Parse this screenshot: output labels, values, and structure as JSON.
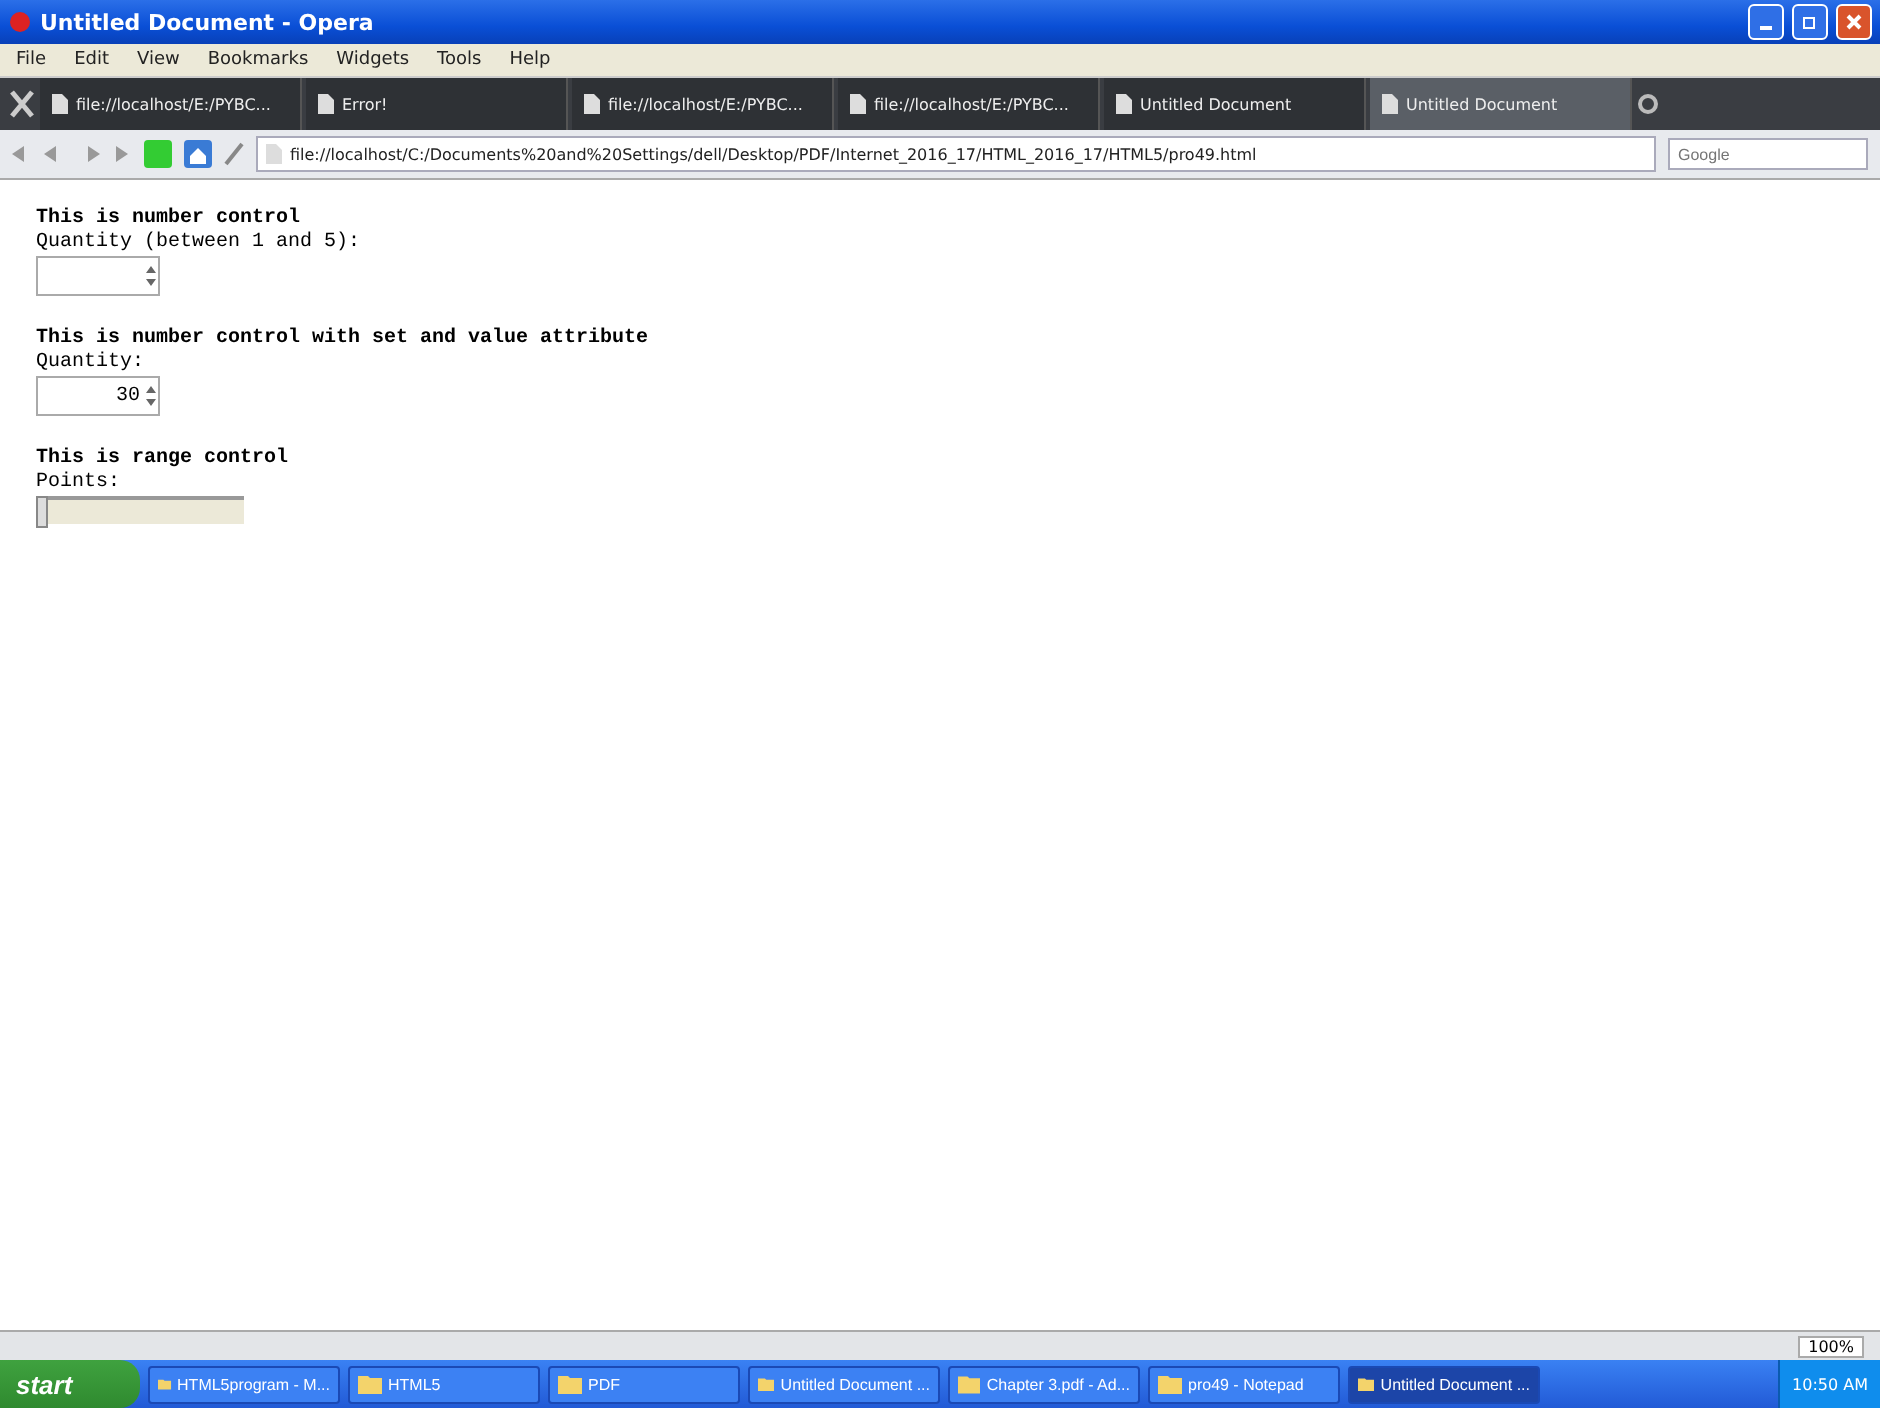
{
  "window": {
    "title": "Untitled Document - Opera"
  },
  "menu": [
    "File",
    "Edit",
    "View",
    "Bookmarks",
    "Widgets",
    "Tools",
    "Help"
  ],
  "tabs": [
    {
      "label": "file://localhost/E:/PYBC...",
      "selected": false
    },
    {
      "label": "Error!",
      "selected": false
    },
    {
      "label": "file://localhost/E:/PYBC...",
      "selected": false
    },
    {
      "label": "file://localhost/E:/PYBC...",
      "selected": false
    },
    {
      "label": "Untitled Document",
      "selected": false
    },
    {
      "label": "Untitled Document",
      "selected": true
    }
  ],
  "address": {
    "value": "file://localhost/C:/Documents%20and%20Settings/dell/Desktop/PDF/Internet_2016_17/HTML_2016_17/HTML5/pro49.html"
  },
  "search": {
    "placeholder": "Google"
  },
  "sections": [
    {
      "heading": "This is number control",
      "label": "Quantity (between 1 and 5):",
      "kind": "number"
    },
    {
      "heading": "This is number control with set and value attribute",
      "label": "Quantity:",
      "kind": "number",
      "value": "30"
    },
    {
      "heading": "This is range control",
      "label": "Points:",
      "kind": "range",
      "level": 0
    }
  ],
  "status_bar": {
    "zoom": "100%"
  },
  "taskbar": {
    "start": "start",
    "items": [
      {
        "label": "HTML5program - M...",
        "selected": false
      },
      {
        "label": "HTML5",
        "selected": false
      },
      {
        "label": "PDF",
        "selected": false
      },
      {
        "label": "Untitled Document ...",
        "selected": false
      },
      {
        "label": "Chapter 3.pdf - Ad...",
        "selected": false
      },
      {
        "label": "pro49 - Notepad",
        "selected": false
      },
      {
        "label": "Untitled Document ...",
        "selected": true
      }
    ],
    "clock": "10:50 AM"
  }
}
